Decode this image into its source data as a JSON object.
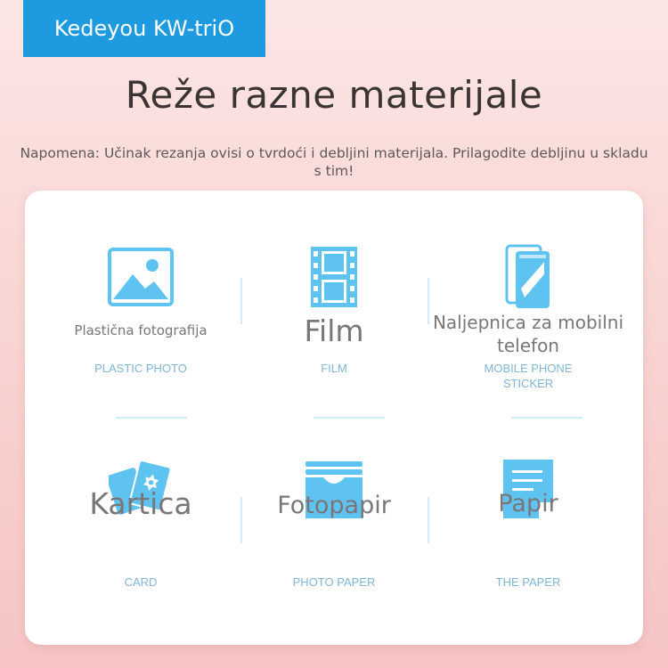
{
  "brand": {
    "text": "Kedeyou KW-triO"
  },
  "title": "Reže razne materijale",
  "note": "Napomena: Učinak rezanja ovisi o tvrdoći i debljini materijala. Prilagodite debljinu u skladu s tim!",
  "materials": [
    {
      "label": "Plastična fotografija",
      "sub": "PLASTIC PHOTO",
      "icon": "photo-icon"
    },
    {
      "label": "Film",
      "sub": "FILM",
      "icon": "film-icon"
    },
    {
      "label": "Naljepnica za mobilni telefon",
      "sub": "MOBILE PHONE STICKER",
      "icon": "phone-sticker-icon"
    },
    {
      "label": "Kartica",
      "sub": "CARD",
      "icon": "card-icon"
    },
    {
      "label": "Fotopapir",
      "sub": "PHOTO PAPER",
      "icon": "photo-paper-icon"
    },
    {
      "label": "Papir",
      "sub": "THE PAPER",
      "icon": "paper-icon"
    }
  ],
  "colors": {
    "brand": "#1e9be0",
    "icon": "#5fc3f2",
    "sub_text": "#7fb5d8"
  }
}
